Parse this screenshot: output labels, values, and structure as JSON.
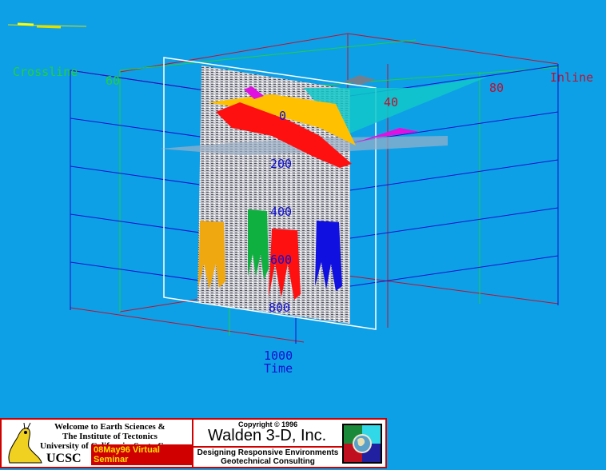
{
  "axes": {
    "crossline_label": "Crossline",
    "crossline_tick": "60",
    "inline_label": "Inline",
    "inline_ticks": [
      "40",
      "80"
    ],
    "time_ticks": [
      "0",
      "200",
      "400",
      "600",
      "800",
      "1000"
    ],
    "time_label": "Time"
  },
  "colors": {
    "background": "#0ea0e6",
    "box_blue": "#1010d0",
    "box_red": "#c01030",
    "box_green": "#20d040",
    "horizon_red": "#ff1010",
    "horizon_yellow": "#ffc000",
    "horizon_cyan": "#10c8c8",
    "horizon_magenta": "#e010e0",
    "well_orange": "#f0a810",
    "well_green": "#10b040",
    "well_red": "#ff1010",
    "well_blue": "#1010e0"
  },
  "icons": {
    "corner": "legend-dash-icon",
    "ucsc_logo": "banana-slug-icon",
    "walden_logo": "globe-quadrant-icon"
  },
  "banner": {
    "welcome_line1": "Welcome to Earth Sciences &",
    "welcome_line2": "The Institute of Tectonics",
    "welcome_line3": "University of California, Santa Cruz",
    "ucsc": "UCSC",
    "seminar": "08May96 Virtual Seminar",
    "copyright": "Copyright © 1996",
    "company": "Walden 3-D, Inc.",
    "tagline1": "Designing Responsive Environments",
    "tagline2": "Geotechnical Consulting"
  }
}
